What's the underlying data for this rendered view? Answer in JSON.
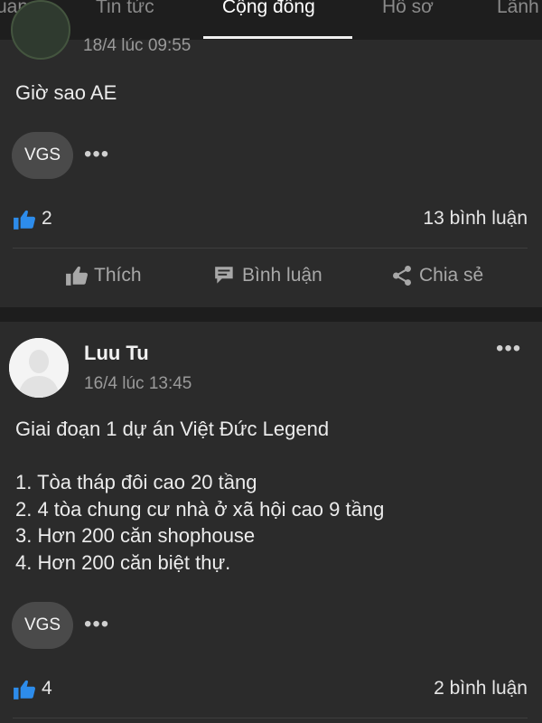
{
  "tabs": [
    {
      "label": "uan"
    },
    {
      "label": "Tin tức"
    },
    {
      "label": "Cộng đồng"
    },
    {
      "label": "Hồ sơ"
    },
    {
      "label": "Lãnh"
    }
  ],
  "posts": [
    {
      "time": "18/4 lúc 09:55",
      "content": "Giờ sao AE",
      "tag": "VGS",
      "more": "•••",
      "likes": "2",
      "comments": "13 bình luận",
      "actions": {
        "like": "Thích",
        "comment": "Bình luận",
        "share": "Chia sẻ"
      }
    },
    {
      "author": "Luu Tu",
      "time": "16/4 lúc 13:45",
      "content": "Giai đoạn 1 dự án Việt Đức Legend\n\n1. Tòa tháp đôi cao 20 tầng\n2. 4 tòa chung cư nhà ở xã hội cao 9 tầng\n3. Hơn 200 căn shophouse\n4. Hơn 200 căn biệt thự.",
      "tag": "VGS",
      "more": "•••",
      "likes": "4",
      "comments": "2 bình luận"
    }
  ],
  "colors": {
    "background": "#2b2b2b",
    "topbar": "#1e1e1e",
    "like_blue": "#2d8ceb",
    "chip": "#4a4a4a"
  }
}
